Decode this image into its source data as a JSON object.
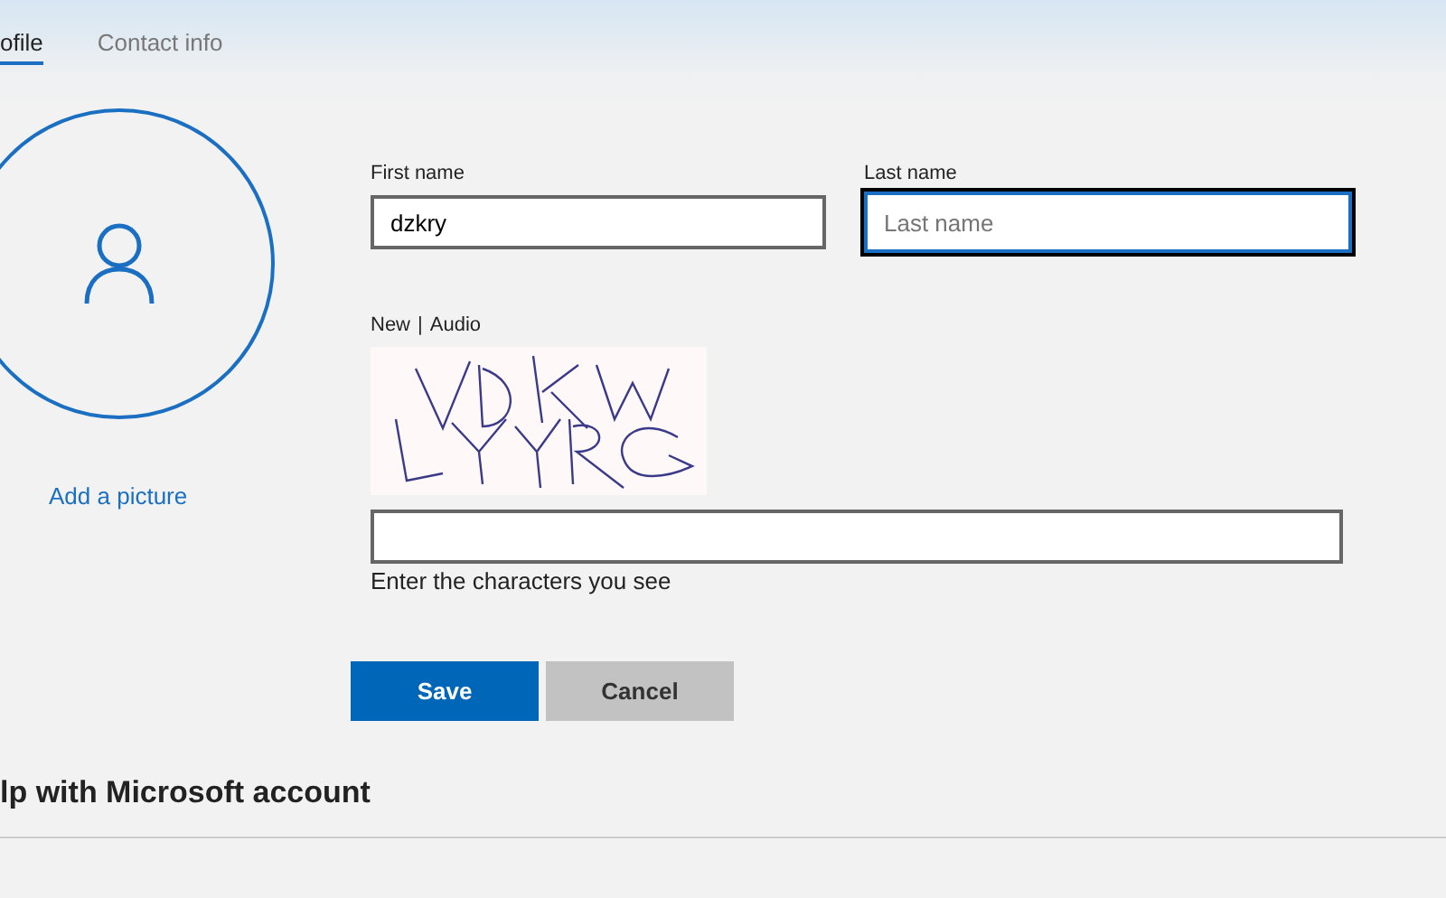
{
  "tabs": [
    {
      "label": "ofile",
      "selected": true
    },
    {
      "label": "Contact info",
      "selected": false
    }
  ],
  "picture": {
    "link": "Add a picture"
  },
  "fields": [
    {
      "label": "First name",
      "value": "dzkry",
      "focused": false
    },
    {
      "label": "Last name",
      "placeholder": "Last name",
      "focused": true
    }
  ],
  "captcha": {
    "links": [
      "New",
      "Audio"
    ],
    "separator": "|",
    "hint": "Enter the characters you see"
  },
  "buttons": [
    {
      "label": "Save",
      "kind": "primary"
    },
    {
      "label": "Cancel",
      "kind": "secondary"
    }
  ],
  "section_heading": "lp with Microsoft account"
}
